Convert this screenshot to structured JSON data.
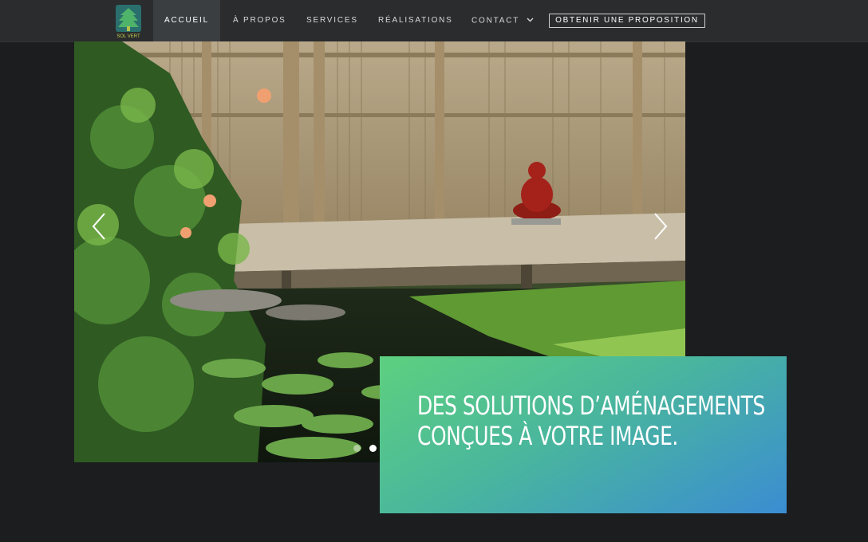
{
  "header": {
    "logo_text": "SOL VERT",
    "nav": [
      {
        "label": "ACCUEIL",
        "active": true
      },
      {
        "label": "À PROPOS",
        "active": false
      },
      {
        "label": "SERVICES",
        "active": false
      },
      {
        "label": "RÉALISATIONS",
        "active": false
      },
      {
        "label": "CONTACT",
        "active": false,
        "icon": "chevron-down-icon"
      }
    ],
    "cta_label": "OBTENIR UNE PROPOSITION"
  },
  "hero": {
    "image_subject": "zen garden with buddha statue, wooden deck, bamboo fence and water lily pond",
    "prev_icon": "chevron-left-icon",
    "next_icon": "chevron-right-icon",
    "slide_count": 2,
    "active_slide": 2
  },
  "callout": {
    "heading": "DES SOLUTIONS D’AMÉNAGEMENTS CONÇUES À VOTRE IMAGE.",
    "gradient": [
      "#5ed07f",
      "#3b8dd2"
    ]
  },
  "colors": {
    "background": "#1c1d1f",
    "topbar": "#2a2c2e",
    "active_nav": "#3b3e41"
  }
}
